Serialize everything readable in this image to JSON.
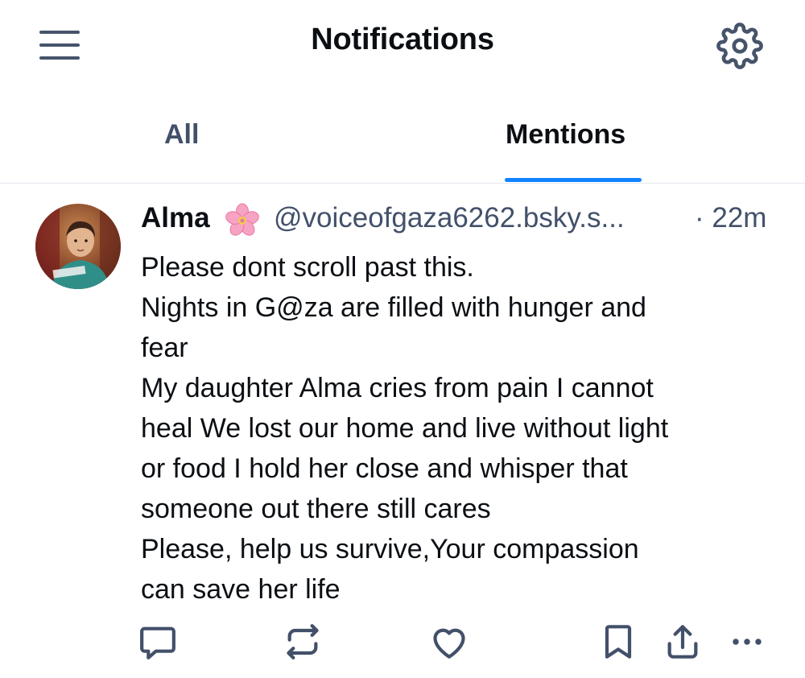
{
  "header": {
    "title": "Notifications",
    "menu_icon": "hamburger-menu-icon",
    "settings_icon": "gear-icon"
  },
  "tabs": [
    {
      "label": "All",
      "selected": false
    },
    {
      "label": "Mentions",
      "selected": true
    }
  ],
  "accent_color": "#1083fe",
  "post": {
    "author": "Alma",
    "author_emoji": "cherry-blossom-icon",
    "handle": "@voiceofgaza6262.bsky.s...",
    "time": "· 22m",
    "lines": [
      "Please  dont scroll past this.",
      "Nights in G@za are filled with hunger and",
      "fear",
      "My daughter Alma cries from pain I cannot",
      "heal We lost our home and live without light",
      "or food I hold her close and whisper that",
      "someone out there still cares",
      "Please, help us survive,Your compassion",
      "can save her life"
    ],
    "actions": [
      "reply-icon",
      "repost-icon",
      "like-icon",
      "bookmark-icon",
      "share-icon",
      "more-icon"
    ]
  }
}
